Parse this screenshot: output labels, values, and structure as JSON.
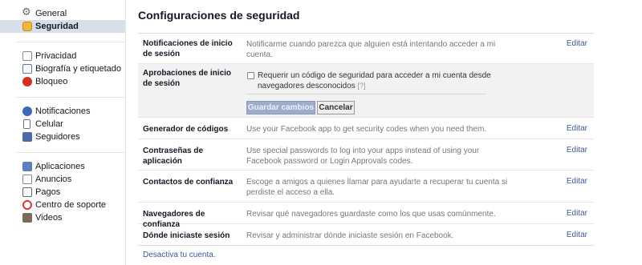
{
  "sidebar": {
    "groups": [
      [
        {
          "label": "General",
          "icon": "gear-icon"
        },
        {
          "label": "Seguridad",
          "icon": "security-icon",
          "selected": true
        }
      ],
      [
        {
          "label": "Privacidad",
          "icon": "privacy-icon"
        },
        {
          "label": "Biografía y etiquetado",
          "icon": "timeline-icon"
        },
        {
          "label": "Bloqueo",
          "icon": "block-icon"
        }
      ],
      [
        {
          "label": "Notificaciones",
          "icon": "globe-icon"
        },
        {
          "label": "Celular",
          "icon": "mobile-icon"
        },
        {
          "label": "Seguidores",
          "icon": "followers-icon"
        }
      ],
      [
        {
          "label": "Aplicaciones",
          "icon": "apps-icon"
        },
        {
          "label": "Anuncios",
          "icon": "ads-icon"
        },
        {
          "label": "Pagos",
          "icon": "payments-icon"
        },
        {
          "label": "Centro de soporte",
          "icon": "support-icon"
        },
        {
          "label": "Videos",
          "icon": "videos-icon"
        }
      ]
    ]
  },
  "main": {
    "title": "Configuraciones de seguridad",
    "rows": [
      {
        "label": "Notificaciones de inicio de sesión",
        "desc": "Notificarme cuando parezca que alguien está intentando acceder a mi cuenta.",
        "edit": "Editar"
      },
      {
        "label": "Aprobaciones de inicio de sesión",
        "expanded": true
      },
      {
        "label": "Generador de códigos",
        "desc": "Use your Facebook app to get security codes when you need them.",
        "edit": "Editar"
      },
      {
        "label": "Contraseñas de aplicación",
        "desc": "Use special passwords to log into your apps instead of using your Facebook password or Login Approvals codes.",
        "edit": "Editar"
      },
      {
        "label": "Contactos de confianza",
        "desc": "Escoge a amigos a quienes llamar para ayudarte a recuperar tu cuenta si perdiste el acceso a ella.",
        "edit": "Editar"
      },
      {
        "label": "Navegadores de confianza",
        "desc": "Revisar qué navegadores guardaste como los que usas comúnmente.",
        "edit": "Editar"
      },
      {
        "label": "Dónde iniciaste sesión",
        "desc": "Revisar y administrar dónde iniciaste sesión en Facebook.",
        "edit": "Editar"
      }
    ],
    "approvals": {
      "checkbox_label": "Requerir un código de seguridad para acceder a mi cuenta desde navegadores desconocidos",
      "help": "[?]",
      "checked": false,
      "save_label": "Guardar cambios",
      "cancel_label": "Cancelar"
    },
    "deactivate_link": "Desactiva tu cuenta."
  }
}
